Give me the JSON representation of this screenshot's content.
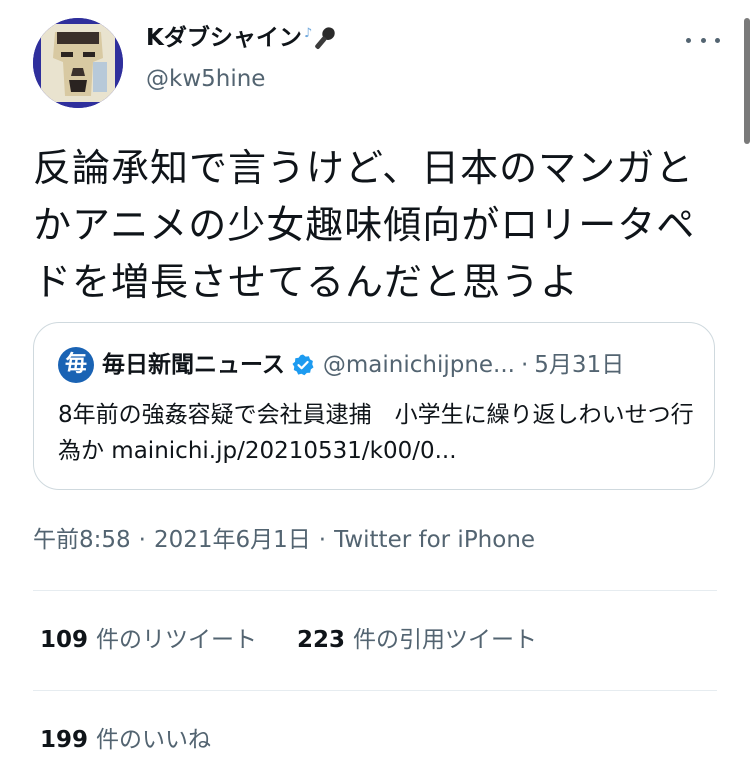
{
  "author": {
    "name": "Kダブシャイン",
    "emoji": "🎤",
    "handle": "@kw5hine"
  },
  "tweet": {
    "text": "反論承知で言うけど、日本のマンガとかアニメの少女趣味傾向がロリータペドを増長させてるんだと思うよ"
  },
  "quoted_tweet": {
    "logo_char": "毎",
    "name": "毎日新聞ニュース",
    "handle": "@mainichijpne...",
    "separator": "·",
    "date": "5月31日",
    "text": "8年前の強姦容疑で会社員逮捕　小学生に繰り返しわいせつ行為か mainichi.jp/20210531/k00/0..."
  },
  "meta": {
    "time": "午前8:58",
    "separator": "·",
    "date": "2021年6月1日",
    "client": "Twitter for iPhone"
  },
  "stats": {
    "retweets_count": "109",
    "retweets_label": "件のリツイート",
    "quotes_count": "223",
    "quotes_label": "件の引用ツイート",
    "likes_count": "199",
    "likes_label": "件のいいね"
  },
  "colors": {
    "secondary_text": "#536471",
    "verified": "#1d9bf0",
    "divider": "#e6ecf0"
  }
}
